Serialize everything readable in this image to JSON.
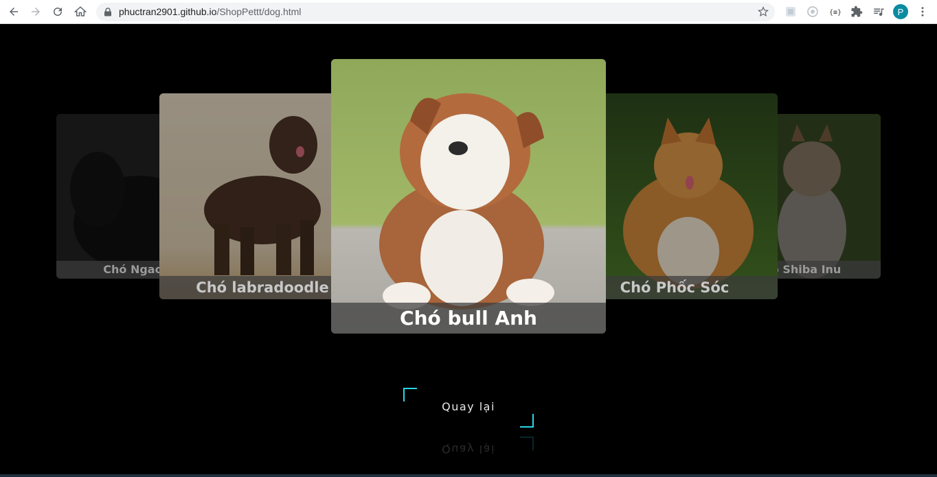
{
  "browser": {
    "url_host": "phuctran2901.github.io",
    "url_path": "/ShopPettt/dog.html",
    "profile_initial": "P",
    "icons": [
      "back-icon",
      "forward-icon",
      "reload-icon",
      "home-icon",
      "lock-icon",
      "star-icon",
      "extension-icon",
      "puzzle-icon",
      "media-icon",
      "menu-icon"
    ]
  },
  "carousel": {
    "far_left": {
      "label": "Chó Ngao Ý"
    },
    "left": {
      "label": "Chó labradoodle"
    },
    "center": {
      "label": "Chó bull Anh"
    },
    "right": {
      "label": "Chó Phốc Sóc"
    },
    "far_right": {
      "label": "Chó Shiba Inu"
    }
  },
  "back_button": {
    "label": "Quay lại"
  },
  "colors": {
    "accent": "#2bd6e6",
    "background": "#000000"
  }
}
